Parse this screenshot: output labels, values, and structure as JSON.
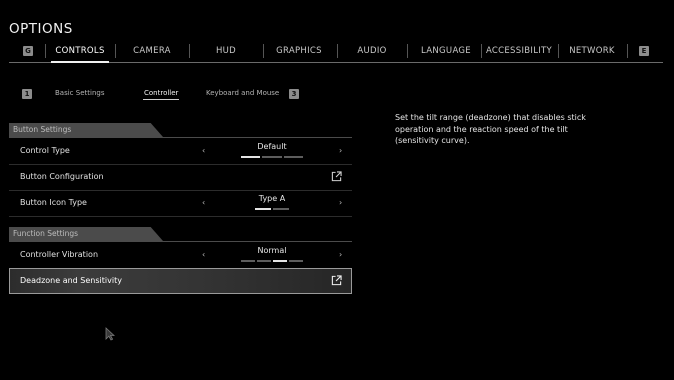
{
  "page": {
    "title": "OPTIONS"
  },
  "top_tabs": {
    "left_key": "G",
    "right_key": "E",
    "items": [
      "CONTROLS",
      "CAMERA",
      "HUD",
      "GRAPHICS",
      "AUDIO",
      "LANGUAGE",
      "ACCESSIBILITY",
      "NETWORK"
    ],
    "active": "CONTROLS"
  },
  "sub_tabs": {
    "left_key": "1",
    "right_key": "3",
    "items": [
      "Basic Settings",
      "Controller",
      "Keyboard and Mouse"
    ],
    "active": "Controller"
  },
  "sections": {
    "button_settings": {
      "header": "Button Settings",
      "rows": [
        {
          "label": "Control Type",
          "value": "Default",
          "pips": [
            1,
            0,
            0
          ]
        },
        {
          "label": "Button Configuration"
        },
        {
          "label": "Button Icon Type",
          "value": "Type A",
          "pips": [
            1,
            0
          ]
        }
      ]
    },
    "function_settings": {
      "header": "Function Settings",
      "rows": [
        {
          "label": "Controller Vibration",
          "value": "Normal",
          "pips": [
            0,
            0,
            1,
            0
          ]
        },
        {
          "label": "Deadzone and Sensitivity",
          "selected": true
        }
      ]
    }
  },
  "arrows": {
    "left": "‹",
    "right": "›"
  },
  "description": "Set the tilt range (deadzone) that disables stick operation and the reaction speed of the tilt (sensitivity curve).",
  "colors": {
    "background": "#000000",
    "text": "#d8d8d8",
    "section_header": "#4b4b4b",
    "pip_on": "#e4e4e4",
    "pip_off": "#5d5d5d"
  }
}
